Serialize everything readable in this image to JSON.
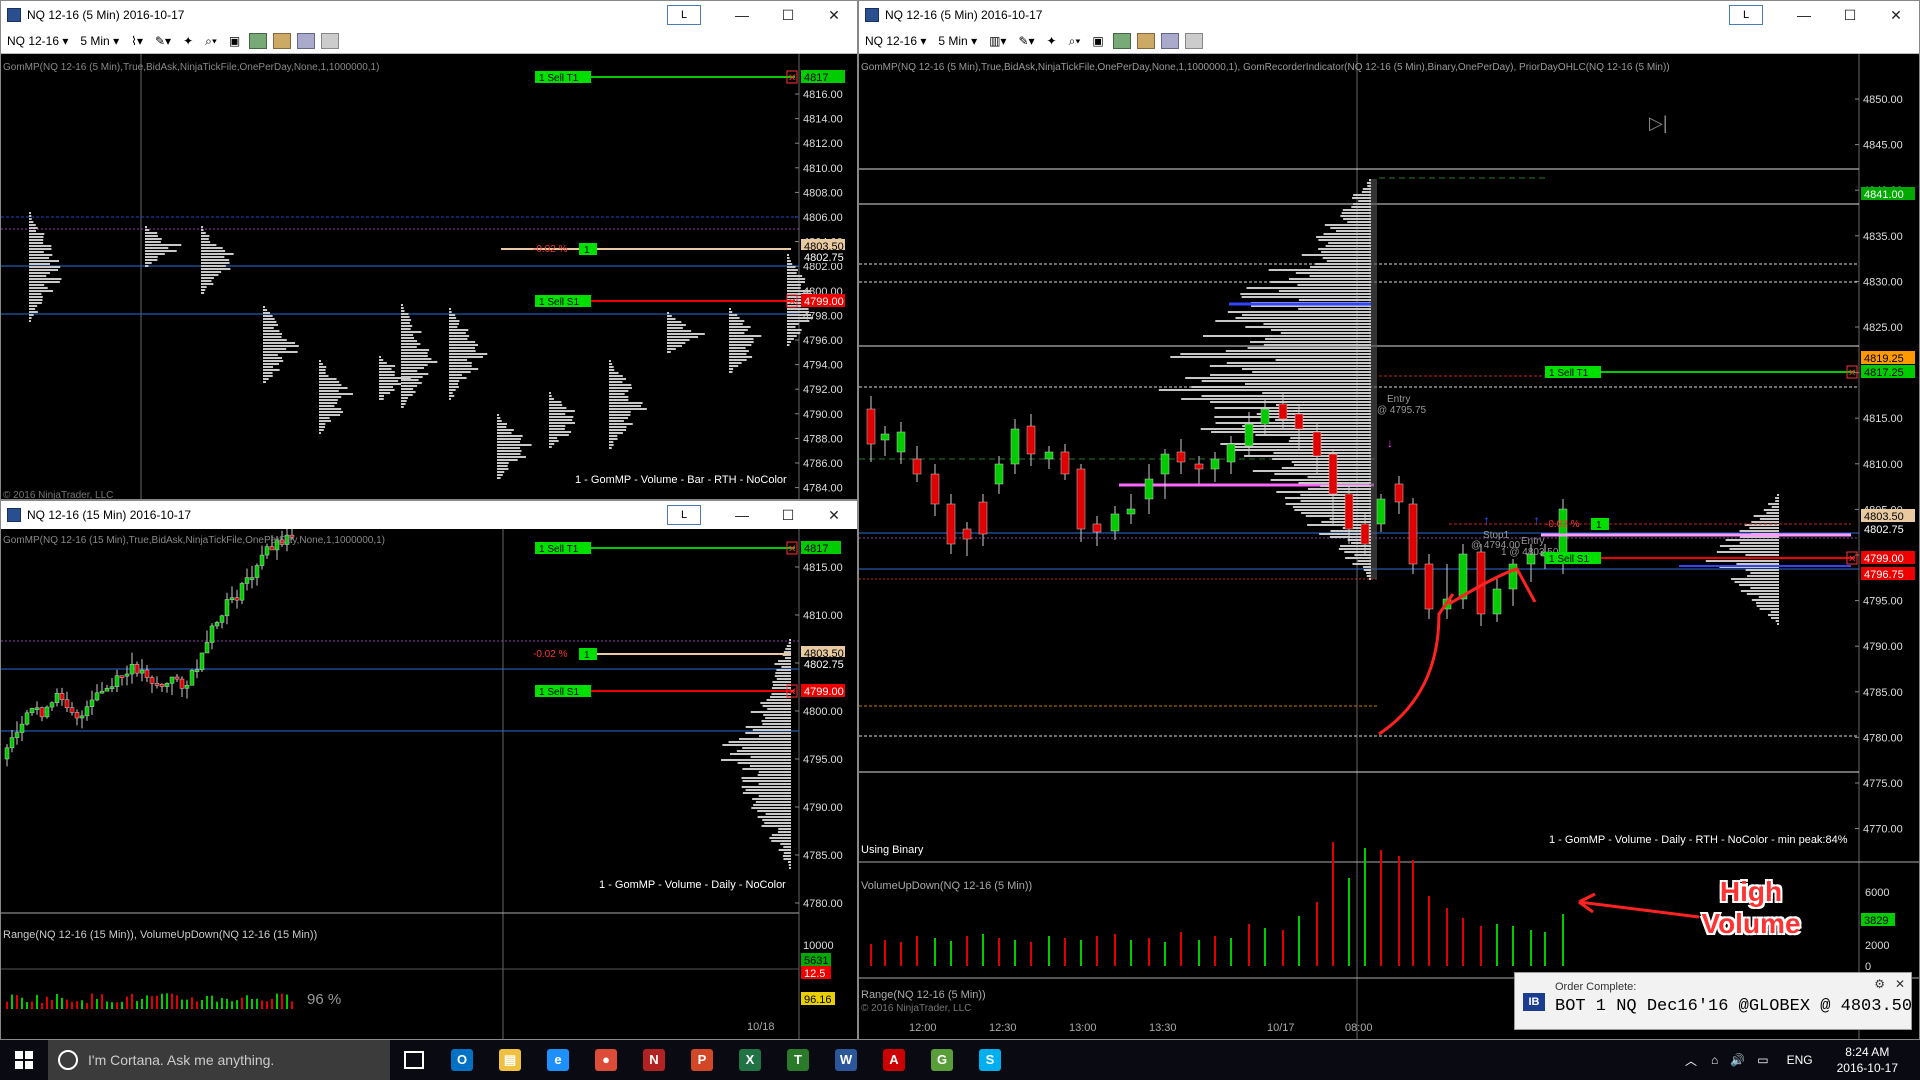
{
  "windows": {
    "w1": {
      "title": "NQ 12-16 (5 Min)  2016-10-17",
      "instrument": "NQ 12-16",
      "period": "5 Min",
      "indicator": "GomMP(NQ 12-16 (5 Min),True,BidAsk,NinjaTickFile,OnePerDay,None,1,1000000,1)",
      "footer": "1 - GomMP  - Volume - Bar - RTH - NoColor",
      "copyright": "© 2016 NinjaTrader, LLC"
    },
    "w2": {
      "title": "NQ 12-16 (15 Min)  2016-10-17",
      "indicator": "GomMP(NQ 12-16 (15 Min),True,BidAsk,NinjaTickFile,OnePerDay,None,1,1000000,1)",
      "footer": "1 - GomMP  - Volume - Daily - NoColor",
      "panel2": "Range(NQ 12-16 (15 Min)), VolumeUpDown(NQ 12-16 (15 Min))",
      "pct": "96 %",
      "date_label": "10/18",
      "panel2_vals": [
        "10000",
        "5631",
        "12.5"
      ],
      "bottom_val": "96.16"
    },
    "w3": {
      "title": "NQ 12-16 (5 Min)  2016-10-17",
      "instrument": "NQ 12-16",
      "period": "5 Min",
      "indicator": "GomMP(NQ 12-16 (5 Min),True,BidAsk,NinjaTickFile,OnePerDay,None,1,1000000,1), GomRecorderIndicator(NQ 12-16 (5 Min),Binary,OnePerDay), PriorDayOHLC(NQ 12-16 (5 Min))",
      "footer": "1 - GomMP  - Volume - Daily - RTH - NoColor - min peak:84%",
      "using": "Using Binary",
      "vol_title": "VolumeUpDown(NQ 12-16 (5 Min))",
      "range_title": "Range(NQ 12-16 (5 Min))",
      "copyright": "© 2016 NinjaTrader, LLC",
      "times": [
        "12:00",
        "12:30",
        "13:00",
        "13:30",
        "10/17",
        "08:00"
      ],
      "entry1": "Entry",
      "entry1b": "@ 4795.75",
      "stop": "Stop1",
      "stop_b": "@ 4794.00",
      "entry2": "Entry",
      "entry2b": "1 @ 4803.50",
      "vol_axis": [
        "6000",
        "4000",
        "3829",
        "2000",
        "0"
      ]
    }
  },
  "labels": {
    "lbtn": "L",
    "sell_t1": "1  Sell T1",
    "sell_s1": "1  Sell S1",
    "pct_label": "-0.02 %",
    "one": "1"
  },
  "axis_w1": [
    "4816.00",
    "4814.00",
    "4812.00",
    "4810.00",
    "4808.00",
    "4806.00",
    "4804.00",
    "4802.00",
    "4800.00",
    "4798.00",
    "4796.00",
    "4794.00",
    "4792.00",
    "4790.00",
    "4788.00",
    "4786.00",
    "4784.00"
  ],
  "badges_w1": {
    "t1": "4817",
    "mid": "4803.50",
    "last": "4802.75",
    "s1": "4799.00"
  },
  "axis_w2": [
    "4815.00",
    "4810.00",
    "4805.00",
    "4800.00",
    "4795.00",
    "4790.00",
    "4785.00",
    "4780.00"
  ],
  "badges_w2": {
    "t1": "4817",
    "mid": "4803.50",
    "last": "4802.75",
    "s1": "4799.00"
  },
  "axis_w3": [
    "4850.00",
    "4845.00",
    "4840.00",
    "4835.00",
    "4830.00",
    "4825.00",
    "4820.00",
    "4815.00",
    "4810.00",
    "4805.00",
    "4800.00",
    "4795.00",
    "4790.00",
    "4785.00",
    "4780.00",
    "4775.00",
    "4770.00"
  ],
  "badges_w3": {
    "top": "4841.00",
    "a": "4819.25",
    "t1": "4817.25",
    "mid": "4803.50",
    "last": "4802.75",
    "s1": "4799.00",
    "low": "4796.75"
  },
  "annotation": {
    "line1": "High",
    "line2": "Volume"
  },
  "toast": {
    "title": "Order Complete:",
    "body": "BOT 1 NQ Dec16'16 @GLOBEX @ 4803.50",
    "badge": "IB"
  },
  "taskbar": {
    "search": "I'm Cortana. Ask me anything.",
    "lang": "ENG",
    "time": "8:24 AM",
    "date": "2016-10-17",
    "apps": [
      {
        "name": "outlook",
        "letter": "O",
        "color": "#0072c6"
      },
      {
        "name": "explorer",
        "letter": "▤",
        "color": "#f0c040"
      },
      {
        "name": "edge",
        "letter": "e",
        "color": "#1e90ff"
      },
      {
        "name": "chrome",
        "letter": "●",
        "color": "#dd4b39"
      },
      {
        "name": "ninja",
        "letter": "N",
        "color": "#b22222"
      },
      {
        "name": "powerpoint",
        "letter": "P",
        "color": "#d24726"
      },
      {
        "name": "excel",
        "letter": "X",
        "color": "#217346"
      },
      {
        "name": "tws",
        "letter": "T",
        "color": "#2a7a2a"
      },
      {
        "name": "word",
        "letter": "W",
        "color": "#2b579a"
      },
      {
        "name": "acrobat",
        "letter": "A",
        "color": "#cc0000"
      },
      {
        "name": "greenapp",
        "letter": "G",
        "color": "#5a9e3a"
      },
      {
        "name": "skype",
        "letter": "S",
        "color": "#00aff0"
      }
    ]
  },
  "colors": {
    "green": "#00cc00",
    "red": "#e00000",
    "pink": "#ff66ff",
    "blue": "#3355ff",
    "tan": "#e8c9a0",
    "profile": "#c8c8c8"
  }
}
